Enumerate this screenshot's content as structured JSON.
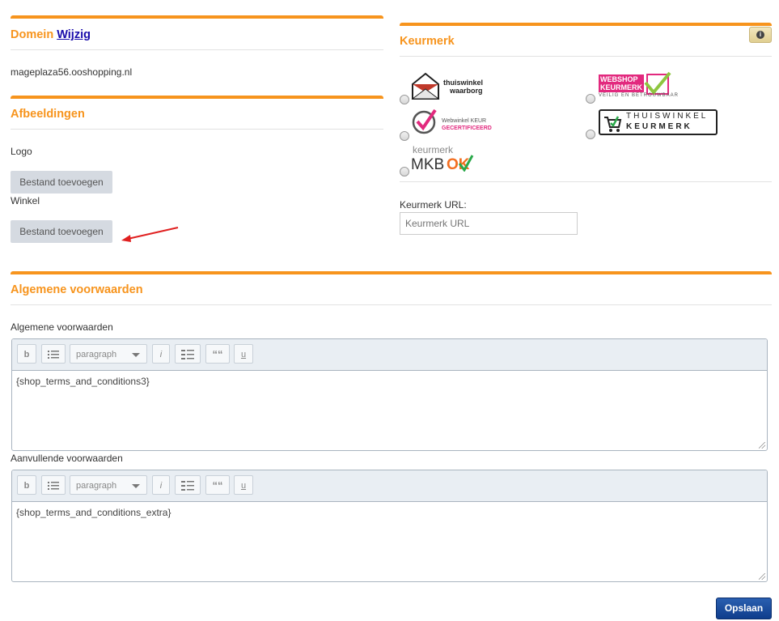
{
  "domain_section": {
    "title": "Domein",
    "edit_link": "Wijzig",
    "domain_value": "mageplaza56.ooshopping.nl"
  },
  "images_section": {
    "title": "Afbeeldingen",
    "logo_label": "Logo",
    "logo_button": "Bestand toevoegen",
    "shop_label": "Winkel",
    "shop_button": "Bestand toevoegen"
  },
  "keurmerk_section": {
    "title": "Keurmerk",
    "info_icon": "info-icon",
    "options": [
      {
        "name": "thuiswinkel-waarborg",
        "line1": "thuiswinkel",
        "line2": "waarborg"
      },
      {
        "name": "webshop-keurmerk",
        "line1": "WEBSHOP",
        "line2": "KEURMERK",
        "line3": "VEILIG EN BETROUWBAAR"
      },
      {
        "name": "webwinkelkeur",
        "line1": "Webwinkel KEUR",
        "line2": "GECERTIFICEERD"
      },
      {
        "name": "thuiswinkel-keurmerk",
        "line1": "THUISWINKEL",
        "line2": "KEURMERK"
      },
      {
        "name": "keurmerk-mkbok",
        "line1": "keurmerk",
        "line2": "MKB",
        "line3": "OK"
      }
    ],
    "url_label": "Keurmerk URL:",
    "url_placeholder": "Keurmerk URL"
  },
  "terms_section": {
    "title": "Algemene voorwaarden",
    "terms_label": "Algemene voorwaarden",
    "terms_value": "{shop_terms_and_conditions3}",
    "extra_label": "Aanvullende voorwaarden",
    "extra_value": "{shop_terms_and_conditions_extra}",
    "toolbar": {
      "bold": "b",
      "list": "list-icon",
      "format_select": "paragraph",
      "italic": "i",
      "ordered_list": "ordered-list-icon",
      "quote": "““",
      "underline": "u"
    }
  },
  "save_button": "Opslaan",
  "colors": {
    "accent": "#f7941d",
    "save": "#0f3d8c"
  }
}
